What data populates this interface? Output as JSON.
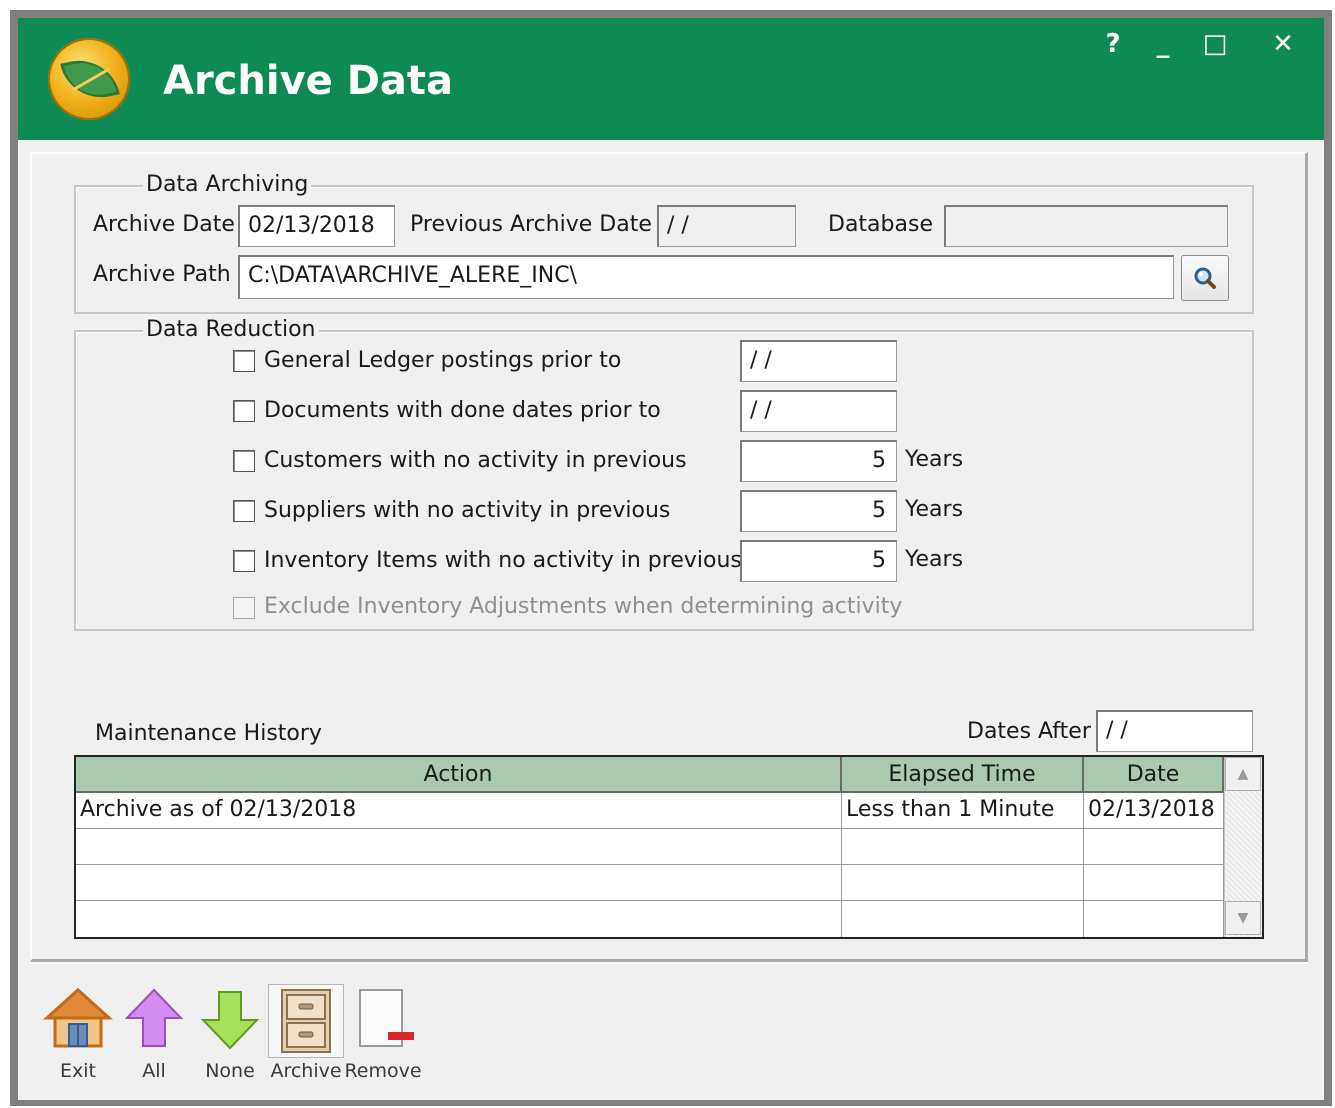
{
  "window": {
    "title": "Archive Data",
    "controls": {
      "help": "?",
      "minimize": "_",
      "maximize": "□",
      "close": "✕"
    }
  },
  "data_archiving": {
    "legend": "Data Archiving",
    "archive_date_label": "Archive Date",
    "archive_date_value": "02/13/2018",
    "previous_archive_date_label": "Previous Archive Date",
    "previous_archive_date_value": " / /",
    "database_label": "Database",
    "database_value": "",
    "archive_path_label": "Archive Path",
    "archive_path_value": "C:\\DATA\\ARCHIVE_ALERE_INC\\"
  },
  "data_reduction": {
    "legend": "Data Reduction",
    "items": [
      {
        "label": "General Ledger postings prior to",
        "value": " / /",
        "unit": "",
        "checked": false
      },
      {
        "label": "Documents with done dates prior to",
        "value": " / /",
        "unit": "",
        "checked": false
      },
      {
        "label": "Customers with no activity in previous",
        "value": "5",
        "unit": "Years",
        "checked": false
      },
      {
        "label": "Suppliers with no activity in previous",
        "value": "5",
        "unit": "Years",
        "checked": false
      },
      {
        "label": "Inventory Items with no activity in previous",
        "value": "5",
        "unit": "Years",
        "checked": false
      }
    ],
    "exclude_label": "Exclude Inventory Adjustments when determining activity"
  },
  "maintenance_history": {
    "label": "Maintenance History",
    "dates_after_label": "Dates After",
    "dates_after_value": " / /",
    "columns": [
      "Action",
      "Elapsed Time",
      "Date"
    ],
    "rows": [
      [
        "Archive as of 02/13/2018",
        "Less than 1 Minute",
        "02/13/2018"
      ]
    ]
  },
  "toolbar": {
    "exit_label": "Exit",
    "all_label": "All",
    "none_label": "None",
    "archive_label": "Archive",
    "remove_label": "Remove"
  },
  "colors": {
    "title_bar": "#0e8a55",
    "grid_header": "#a9c9b1",
    "panel_bg": "#f0f0f0"
  }
}
